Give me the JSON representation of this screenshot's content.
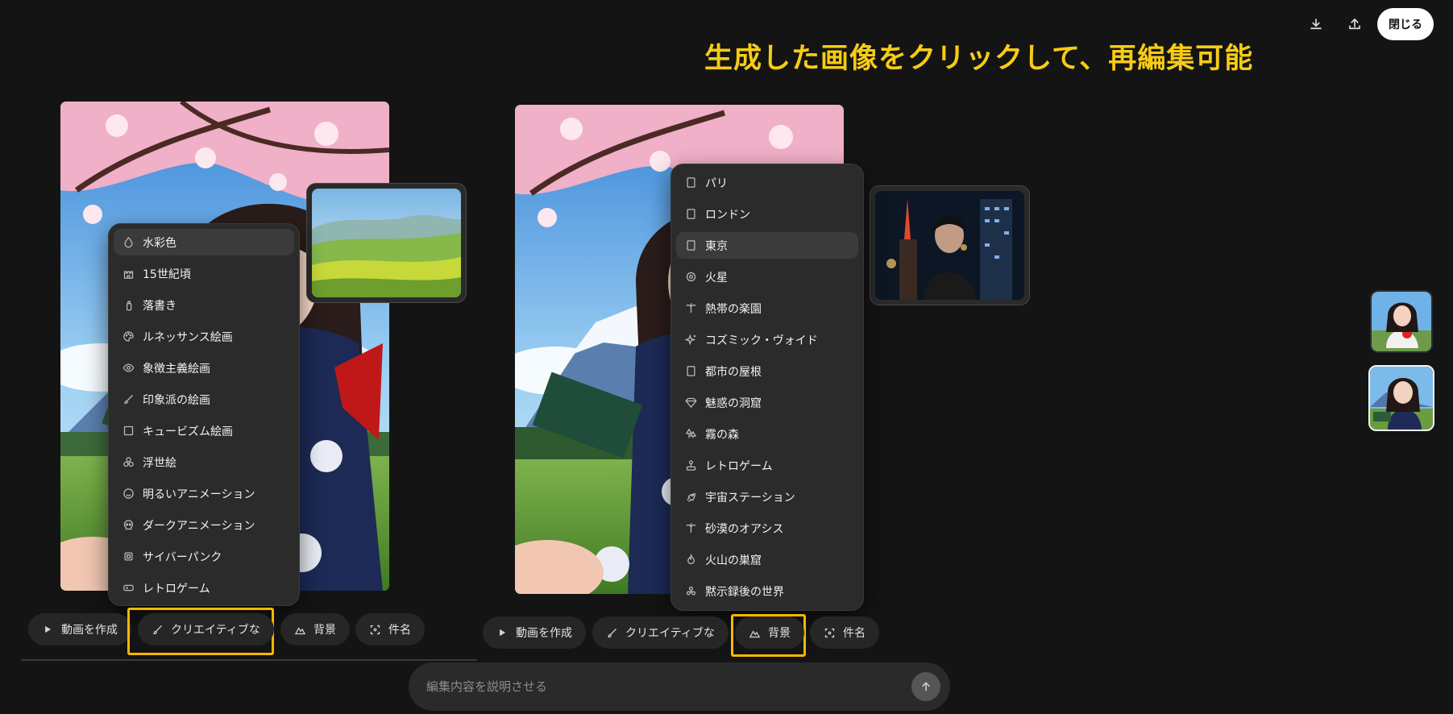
{
  "top_bar": {
    "download_icon": "download-icon",
    "share_icon": "share-icon",
    "close_label": "閉じる"
  },
  "annotation": "生成した画像をクリックして、再編集可能",
  "left_panel": {
    "style_menu": [
      {
        "icon": "droplet-icon",
        "label": "水彩色",
        "selected": true
      },
      {
        "icon": "castle-icon",
        "label": "15世紀頃",
        "selected": false
      },
      {
        "icon": "spray-can-icon",
        "label": "落書き",
        "selected": false
      },
      {
        "icon": "palette-icon",
        "label": "ルネッサンス絵画",
        "selected": false
      },
      {
        "icon": "eye-icon",
        "label": "象徴主義絵画",
        "selected": false
      },
      {
        "icon": "brush-icon",
        "label": "印象派の絵画",
        "selected": false
      },
      {
        "icon": "square-icon",
        "label": "キュービズム絵画",
        "selected": false
      },
      {
        "icon": "shapes-icon",
        "label": "浮世絵",
        "selected": false
      },
      {
        "icon": "smile-icon",
        "label": "明るいアニメーション",
        "selected": false
      },
      {
        "icon": "skull-icon",
        "label": "ダークアニメーション",
        "selected": false
      },
      {
        "icon": "cpu-icon",
        "label": "サイバーパンク",
        "selected": false
      },
      {
        "icon": "gamepad-icon",
        "label": "レトロゲーム",
        "selected": false
      }
    ],
    "toolbar": {
      "make_video": "動画を作成",
      "creative": "クリエイティブな",
      "background": "背景",
      "subject": "件名"
    }
  },
  "right_panel": {
    "background_menu": [
      {
        "icon": "building-icon",
        "label": "パリ",
        "selected": false
      },
      {
        "icon": "building-icon",
        "label": "ロンドン",
        "selected": false
      },
      {
        "icon": "building-icon",
        "label": "東京",
        "selected": true
      },
      {
        "icon": "planet-icon",
        "label": "火星",
        "selected": false
      },
      {
        "icon": "palm-tree-icon",
        "label": "熱帯の楽園",
        "selected": false
      },
      {
        "icon": "sparkles-icon",
        "label": "コズミック・ヴォイド",
        "selected": false
      },
      {
        "icon": "building-icon",
        "label": "都市の屋根",
        "selected": false
      },
      {
        "icon": "gem-icon",
        "label": "魅惑の洞窟",
        "selected": false
      },
      {
        "icon": "trees-icon",
        "label": "霧の森",
        "selected": false
      },
      {
        "icon": "joystick-icon",
        "label": "レトロゲーム",
        "selected": false
      },
      {
        "icon": "rocket-icon",
        "label": "宇宙ステーション",
        "selected": false
      },
      {
        "icon": "palm-tree-icon",
        "label": "砂漠のオアシス",
        "selected": false
      },
      {
        "icon": "flame-icon",
        "label": "火山の巣窟",
        "selected": false
      },
      {
        "icon": "biohazard-icon",
        "label": "黙示録後の世界",
        "selected": false
      }
    ],
    "toolbar": {
      "make_video": "動画を作成",
      "creative": "クリエイティブな",
      "background": "背景",
      "subject": "件名"
    }
  },
  "prompt_input": {
    "placeholder": "編集内容を説明させる",
    "value": ""
  },
  "highlight_color": "#f5b800",
  "annotation_color": "#f7cc13"
}
